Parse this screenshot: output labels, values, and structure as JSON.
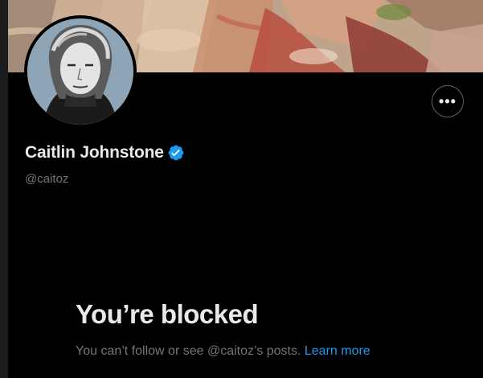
{
  "profile": {
    "display_name": "Caitlin Johnstone",
    "handle": "@caitoz",
    "verified": true
  },
  "actions": {
    "more_label": "•••"
  },
  "blocked": {
    "title": "You’re blocked",
    "message": "You can’t follow or see @caitoz’s posts.",
    "link_label": "Learn more"
  },
  "colors": {
    "background": "#000000",
    "primary_text": "#e7e9ea",
    "secondary_text": "#71767b",
    "link": "#1d9bf0",
    "verified_badge": "#1d9bf0",
    "button_border": "#536471"
  },
  "icons": {
    "more": "more-horizontal-icon",
    "verified": "verified-badge-icon"
  }
}
